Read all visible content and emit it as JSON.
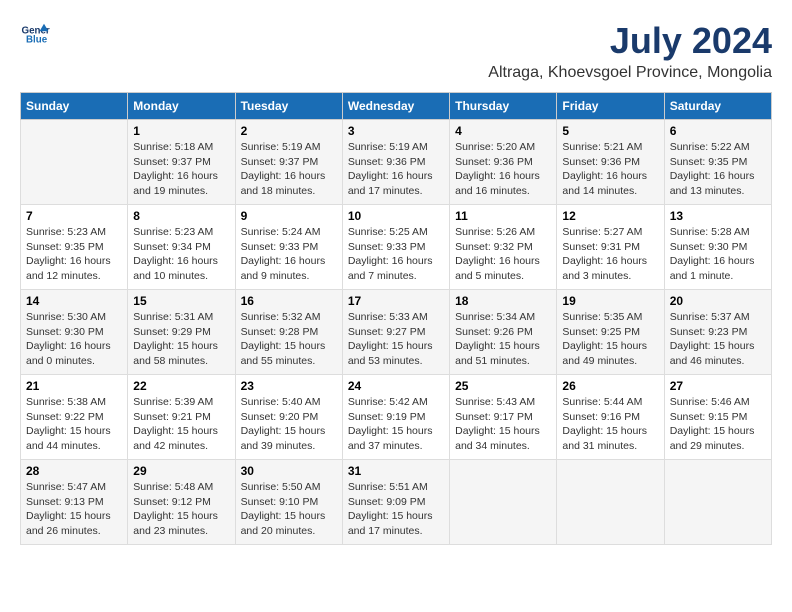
{
  "logo": {
    "line1": "General",
    "line2": "Blue"
  },
  "title": "July 2024",
  "subtitle": "Altraga, Khoevsgoel Province, Mongolia",
  "days_of_week": [
    "Sunday",
    "Monday",
    "Tuesday",
    "Wednesday",
    "Thursday",
    "Friday",
    "Saturday"
  ],
  "weeks": [
    [
      {
        "day": "",
        "info": ""
      },
      {
        "day": "1",
        "info": "Sunrise: 5:18 AM\nSunset: 9:37 PM\nDaylight: 16 hours\nand 19 minutes."
      },
      {
        "day": "2",
        "info": "Sunrise: 5:19 AM\nSunset: 9:37 PM\nDaylight: 16 hours\nand 18 minutes."
      },
      {
        "day": "3",
        "info": "Sunrise: 5:19 AM\nSunset: 9:36 PM\nDaylight: 16 hours\nand 17 minutes."
      },
      {
        "day": "4",
        "info": "Sunrise: 5:20 AM\nSunset: 9:36 PM\nDaylight: 16 hours\nand 16 minutes."
      },
      {
        "day": "5",
        "info": "Sunrise: 5:21 AM\nSunset: 9:36 PM\nDaylight: 16 hours\nand 14 minutes."
      },
      {
        "day": "6",
        "info": "Sunrise: 5:22 AM\nSunset: 9:35 PM\nDaylight: 16 hours\nand 13 minutes."
      }
    ],
    [
      {
        "day": "7",
        "info": "Sunrise: 5:23 AM\nSunset: 9:35 PM\nDaylight: 16 hours\nand 12 minutes."
      },
      {
        "day": "8",
        "info": "Sunrise: 5:23 AM\nSunset: 9:34 PM\nDaylight: 16 hours\nand 10 minutes."
      },
      {
        "day": "9",
        "info": "Sunrise: 5:24 AM\nSunset: 9:33 PM\nDaylight: 16 hours\nand 9 minutes."
      },
      {
        "day": "10",
        "info": "Sunrise: 5:25 AM\nSunset: 9:33 PM\nDaylight: 16 hours\nand 7 minutes."
      },
      {
        "day": "11",
        "info": "Sunrise: 5:26 AM\nSunset: 9:32 PM\nDaylight: 16 hours\nand 5 minutes."
      },
      {
        "day": "12",
        "info": "Sunrise: 5:27 AM\nSunset: 9:31 PM\nDaylight: 16 hours\nand 3 minutes."
      },
      {
        "day": "13",
        "info": "Sunrise: 5:28 AM\nSunset: 9:30 PM\nDaylight: 16 hours\nand 1 minute."
      }
    ],
    [
      {
        "day": "14",
        "info": "Sunrise: 5:30 AM\nSunset: 9:30 PM\nDaylight: 16 hours\nand 0 minutes."
      },
      {
        "day": "15",
        "info": "Sunrise: 5:31 AM\nSunset: 9:29 PM\nDaylight: 15 hours\nand 58 minutes."
      },
      {
        "day": "16",
        "info": "Sunrise: 5:32 AM\nSunset: 9:28 PM\nDaylight: 15 hours\nand 55 minutes."
      },
      {
        "day": "17",
        "info": "Sunrise: 5:33 AM\nSunset: 9:27 PM\nDaylight: 15 hours\nand 53 minutes."
      },
      {
        "day": "18",
        "info": "Sunrise: 5:34 AM\nSunset: 9:26 PM\nDaylight: 15 hours\nand 51 minutes."
      },
      {
        "day": "19",
        "info": "Sunrise: 5:35 AM\nSunset: 9:25 PM\nDaylight: 15 hours\nand 49 minutes."
      },
      {
        "day": "20",
        "info": "Sunrise: 5:37 AM\nSunset: 9:23 PM\nDaylight: 15 hours\nand 46 minutes."
      }
    ],
    [
      {
        "day": "21",
        "info": "Sunrise: 5:38 AM\nSunset: 9:22 PM\nDaylight: 15 hours\nand 44 minutes."
      },
      {
        "day": "22",
        "info": "Sunrise: 5:39 AM\nSunset: 9:21 PM\nDaylight: 15 hours\nand 42 minutes."
      },
      {
        "day": "23",
        "info": "Sunrise: 5:40 AM\nSunset: 9:20 PM\nDaylight: 15 hours\nand 39 minutes."
      },
      {
        "day": "24",
        "info": "Sunrise: 5:42 AM\nSunset: 9:19 PM\nDaylight: 15 hours\nand 37 minutes."
      },
      {
        "day": "25",
        "info": "Sunrise: 5:43 AM\nSunset: 9:17 PM\nDaylight: 15 hours\nand 34 minutes."
      },
      {
        "day": "26",
        "info": "Sunrise: 5:44 AM\nSunset: 9:16 PM\nDaylight: 15 hours\nand 31 minutes."
      },
      {
        "day": "27",
        "info": "Sunrise: 5:46 AM\nSunset: 9:15 PM\nDaylight: 15 hours\nand 29 minutes."
      }
    ],
    [
      {
        "day": "28",
        "info": "Sunrise: 5:47 AM\nSunset: 9:13 PM\nDaylight: 15 hours\nand 26 minutes."
      },
      {
        "day": "29",
        "info": "Sunrise: 5:48 AM\nSunset: 9:12 PM\nDaylight: 15 hours\nand 23 minutes."
      },
      {
        "day": "30",
        "info": "Sunrise: 5:50 AM\nSunset: 9:10 PM\nDaylight: 15 hours\nand 20 minutes."
      },
      {
        "day": "31",
        "info": "Sunrise: 5:51 AM\nSunset: 9:09 PM\nDaylight: 15 hours\nand 17 minutes."
      },
      {
        "day": "",
        "info": ""
      },
      {
        "day": "",
        "info": ""
      },
      {
        "day": "",
        "info": ""
      }
    ]
  ]
}
